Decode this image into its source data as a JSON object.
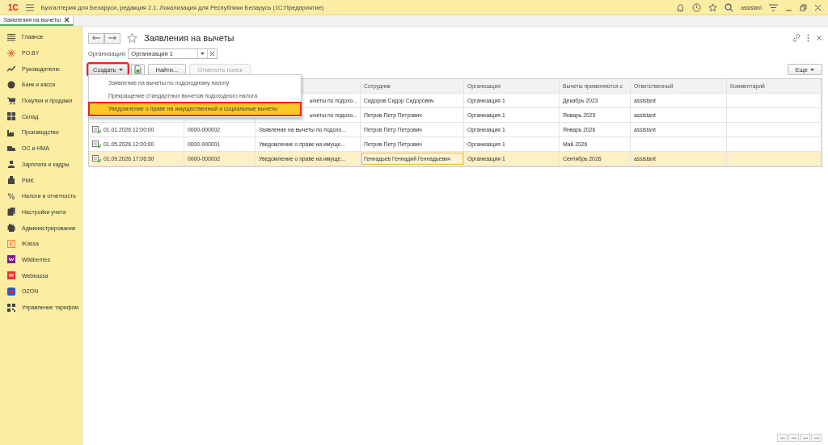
{
  "window": {
    "logo": "1С",
    "title": "Бухгалтерия для Беларуси, редакция 2.1. Локализация для Республики Беларусь  (1С:Предприятие)",
    "user": "assistant"
  },
  "tabs": [
    {
      "label": "Заявления на вычеты",
      "selected": true
    }
  ],
  "sidebar": {
    "items": [
      {
        "label": "Главное"
      },
      {
        "label": "PO.BY"
      },
      {
        "label": "Руководителю"
      },
      {
        "label": "Банк и касса"
      },
      {
        "label": "Покупки и продажи"
      },
      {
        "label": "Склад"
      },
      {
        "label": "Производство"
      },
      {
        "label": "ОС и НМА"
      },
      {
        "label": "Зарплата и кадры"
      },
      {
        "label": "РМК"
      },
      {
        "label": "Налоги и отчетность"
      },
      {
        "label": "Настройки учета"
      },
      {
        "label": "Администрирование"
      },
      {
        "label": "iKassa"
      },
      {
        "label": "Wildberries"
      },
      {
        "label": "Webkassa"
      },
      {
        "label": "OZON"
      },
      {
        "label": "Управление тарифом"
      }
    ]
  },
  "form": {
    "title": "Заявления на вычеты",
    "organization_label": "Организация:",
    "organization": "Организация 1",
    "toolbar": {
      "create": {
        "label": "Создать",
        "outlined": true
      },
      "find": "Найти...",
      "cancel_search": {
        "label": "Отменить поиск",
        "disabled": true
      },
      "more": "Еще"
    },
    "create_menu": [
      {
        "label": "Заявление на вычеты по подоходному налогу",
        "selected": false,
        "outlined": false
      },
      {
        "label": "Прекращение стандартных вычетов подоходного налога",
        "selected": false,
        "outlined": false
      },
      {
        "label": "Уведомление о праве на имущественный и социальные вычеты",
        "selected": true,
        "outlined": true
      }
    ]
  },
  "table": {
    "columns": [
      "",
      "",
      "",
      "Сотрудник",
      "Организация",
      "Вычеты применяются с",
      "Ответственный",
      "Комментарий"
    ],
    "rows": [
      {
        "kind": "covered",
        "type": "ычеты по подохо...",
        "employee": "Сидоров Сидор Сидорович",
        "organization": "Организация 1",
        "from": "Декабрь 2023",
        "responsible": "assistant",
        "selected": false
      },
      {
        "kind": "covered",
        "type": "ычеты по подохо...",
        "employee": "Петров Петр Петрович",
        "organization": "Организация 1",
        "from": "Январь 2025",
        "responsible": "assistant",
        "selected": false
      },
      {
        "kind": "full",
        "date": "01.01.2026 12:00:00",
        "number": "0000-000002",
        "type": "Заявление на вычеты по подохо...",
        "employee": "Петров Петр Петрович",
        "organization": "Организация 1",
        "from": "Январь 2026",
        "responsible": "assistant",
        "selected": false
      },
      {
        "kind": "full",
        "date": "01.05.2026 12:00:00",
        "number": "0000-000001",
        "type": "Уведомление о праве на имуще...",
        "employee": "Петров Петр Петрович",
        "organization": "Организация 1",
        "from": "Май 2026",
        "selected": false
      },
      {
        "kind": "full",
        "date": "01.09.2026 17:06:30",
        "number": "0000-000002",
        "type": "Уведомление о праве на имуще...",
        "employee": "Геннадьев Геннадий Геннадьевич",
        "organization": "Организация 1",
        "from": "Сентябрь 2026",
        "responsible": "assistant",
        "selected": true
      }
    ]
  }
}
